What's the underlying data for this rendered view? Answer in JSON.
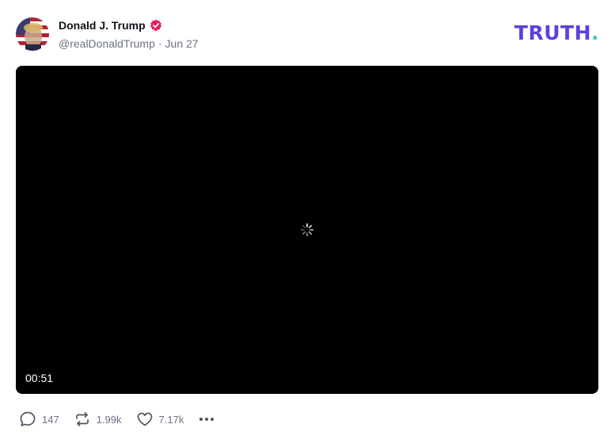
{
  "post": {
    "author": {
      "display_name": "Donald J. Trump",
      "handle": "@realDonaldTrump",
      "verified": true
    },
    "separator": "·",
    "date": "Jun 27",
    "video": {
      "duration": "00:51",
      "state": "loading"
    },
    "actions": {
      "replies": "147",
      "retruths": "1.99k",
      "likes": "7.17k"
    }
  },
  "brand": {
    "logo_text": "TRUTH",
    "logo_dot": ".",
    "accent_color": "#5e3fe0",
    "dot_color": "#2dd4bf",
    "verified_color": "#e0245e"
  },
  "icons": [
    "verified-badge-icon",
    "reply-icon",
    "retruth-icon",
    "like-icon",
    "more-icon",
    "loading-spinner-icon"
  ]
}
